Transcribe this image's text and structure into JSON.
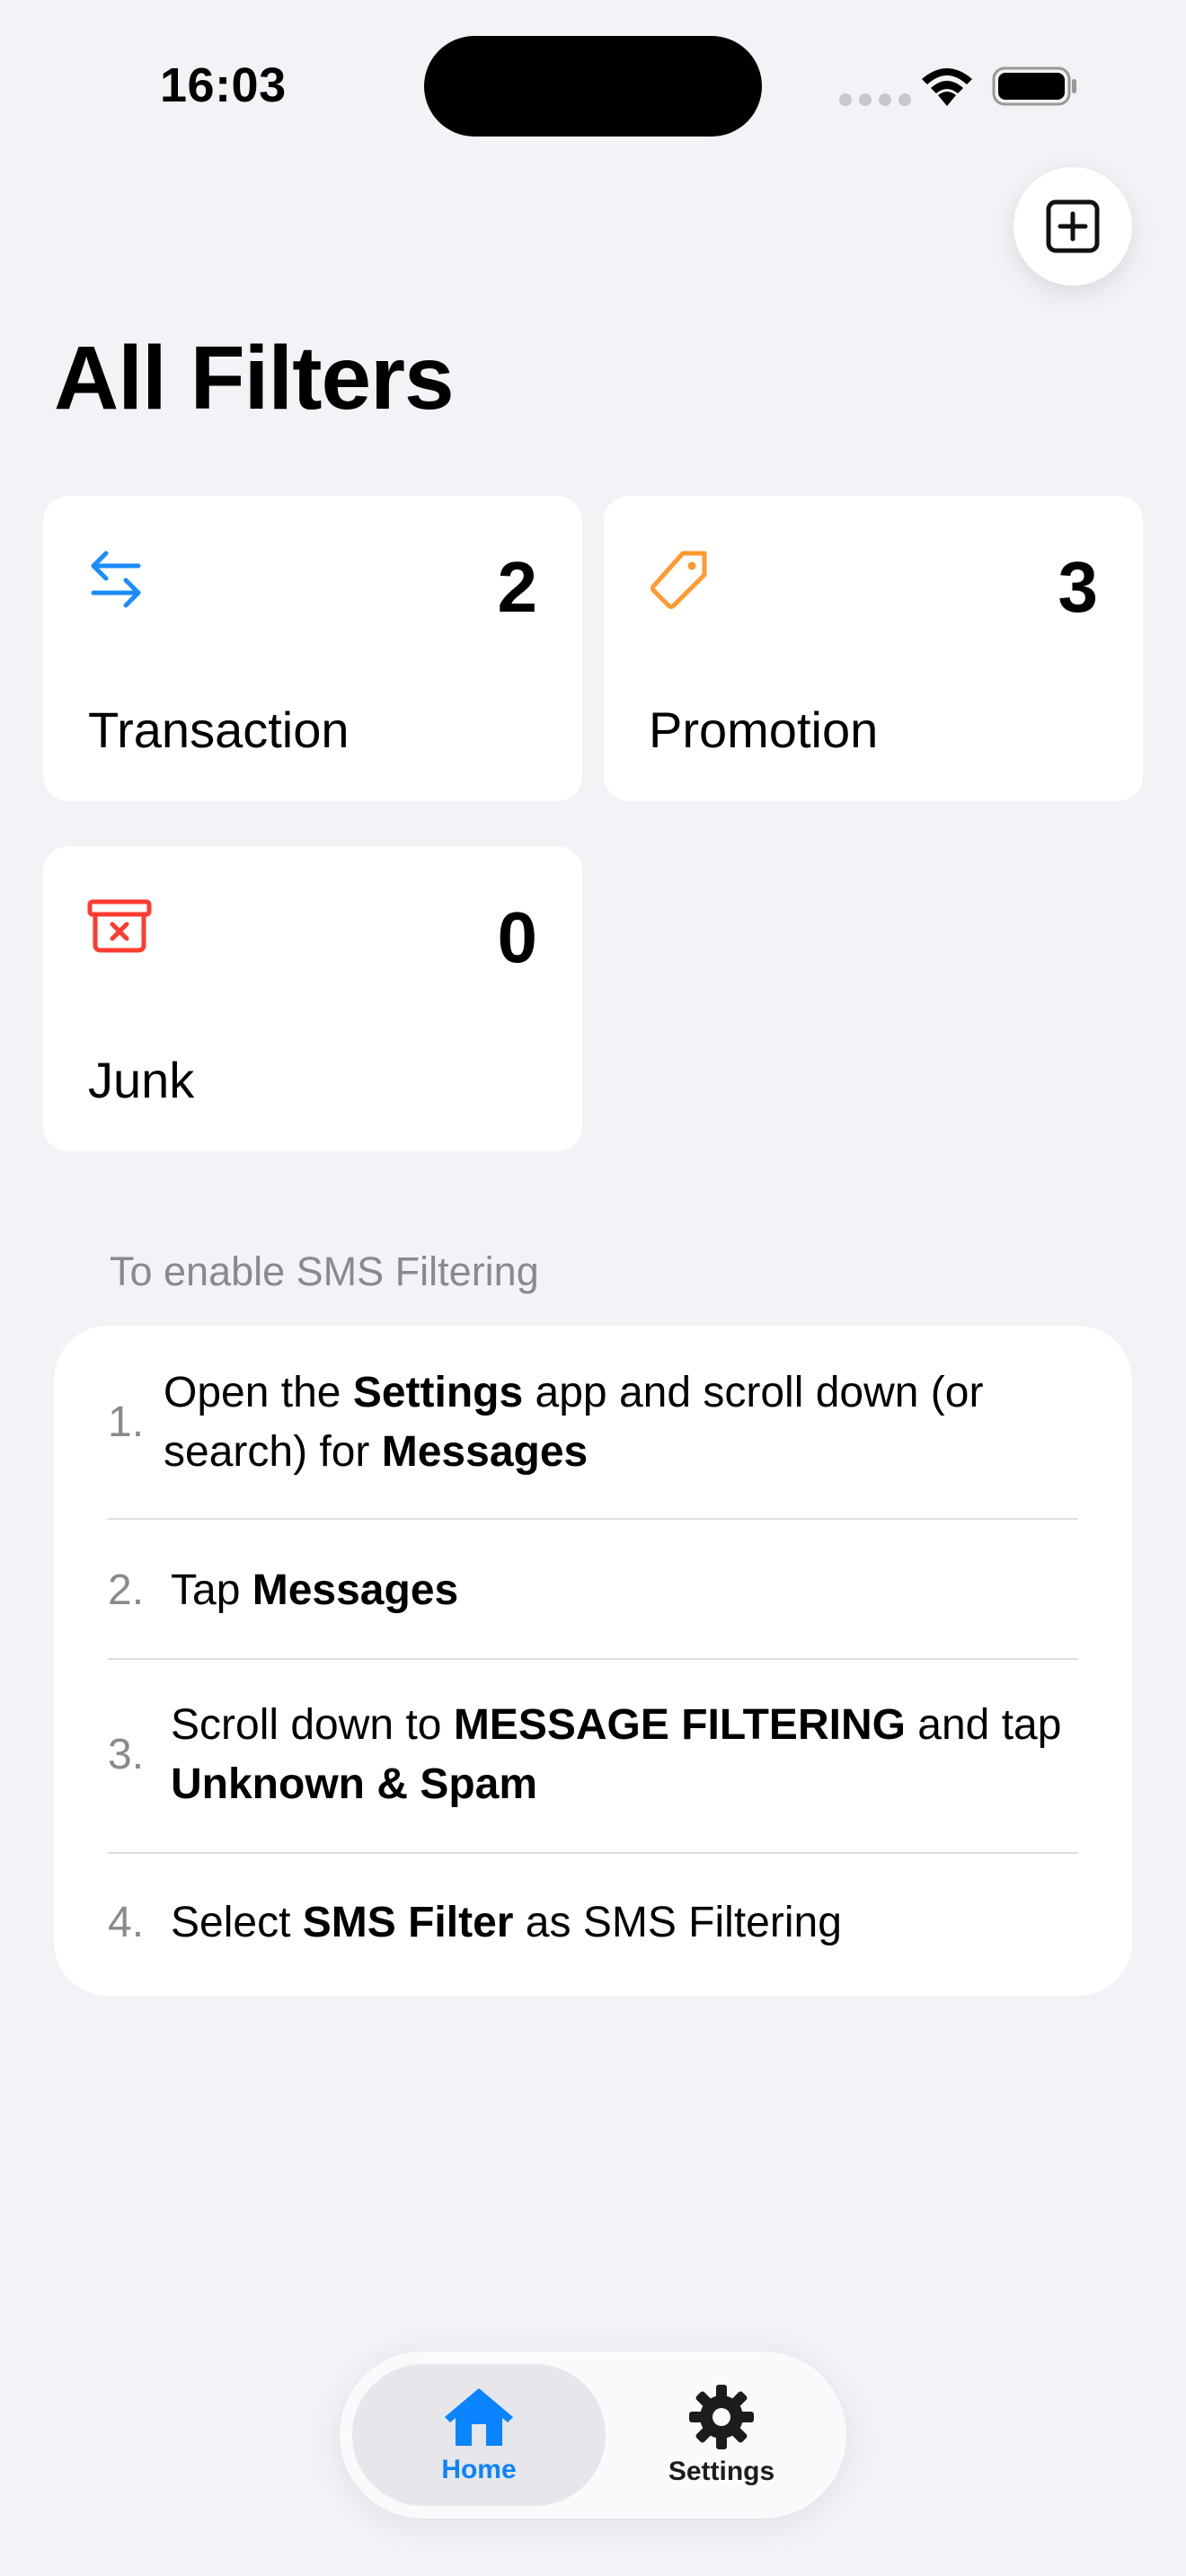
{
  "status_bar": {
    "time": "16:03"
  },
  "header": {
    "title": "All Filters"
  },
  "filters": [
    {
      "label": "Transaction",
      "count": "2",
      "icon": "arrows-left-right-icon",
      "color": "#1a8cff"
    },
    {
      "label": "Promotion",
      "count": "3",
      "icon": "tag-icon",
      "color": "#ff9a2e"
    },
    {
      "label": "Junk",
      "count": "0",
      "icon": "trash-x-icon",
      "color": "#ff3b30"
    }
  ],
  "instructions": {
    "header": "To enable SMS Filtering",
    "steps": [
      {
        "number": "1.",
        "parts": [
          "Open the ",
          "Settings",
          " app and scroll down (or search) for ",
          "Messages"
        ]
      },
      {
        "number": "2.",
        "parts": [
          "Tap ",
          "Messages"
        ]
      },
      {
        "number": "3.",
        "parts": [
          "Scroll down to ",
          "MESSAGE FILTERING",
          " and tap ",
          "Unknown & Spam"
        ]
      },
      {
        "number": "4.",
        "parts": [
          "Select ",
          "SMS Filter",
          " as SMS Filtering"
        ]
      }
    ]
  },
  "tab_bar": {
    "tabs": [
      {
        "label": "Home",
        "icon": "house-icon",
        "active": true
      },
      {
        "label": "Settings",
        "icon": "gear-icon",
        "active": false
      }
    ],
    "accent": "#0a84ff"
  }
}
